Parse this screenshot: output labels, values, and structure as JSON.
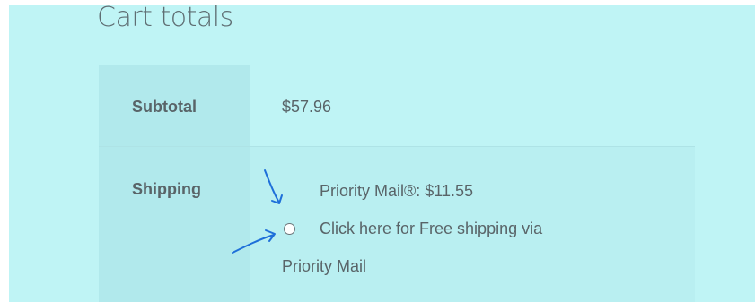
{
  "cart": {
    "title": "Cart totals",
    "subtotal_label": "Subtotal",
    "subtotal_value": "$57.96",
    "shipping_label": "Shipping",
    "shipping_rate": "Priority Mail®: $11.55",
    "free_option_line1": "Click here for Free shipping via",
    "free_option_line2": "Priority Mail",
    "free_option_selected": false
  },
  "colors": {
    "panel_bg": "#bff4f5",
    "label_column_bg": "#b1e9ec",
    "text": "#596468",
    "annotation_arrow": "#1e6fd9"
  }
}
